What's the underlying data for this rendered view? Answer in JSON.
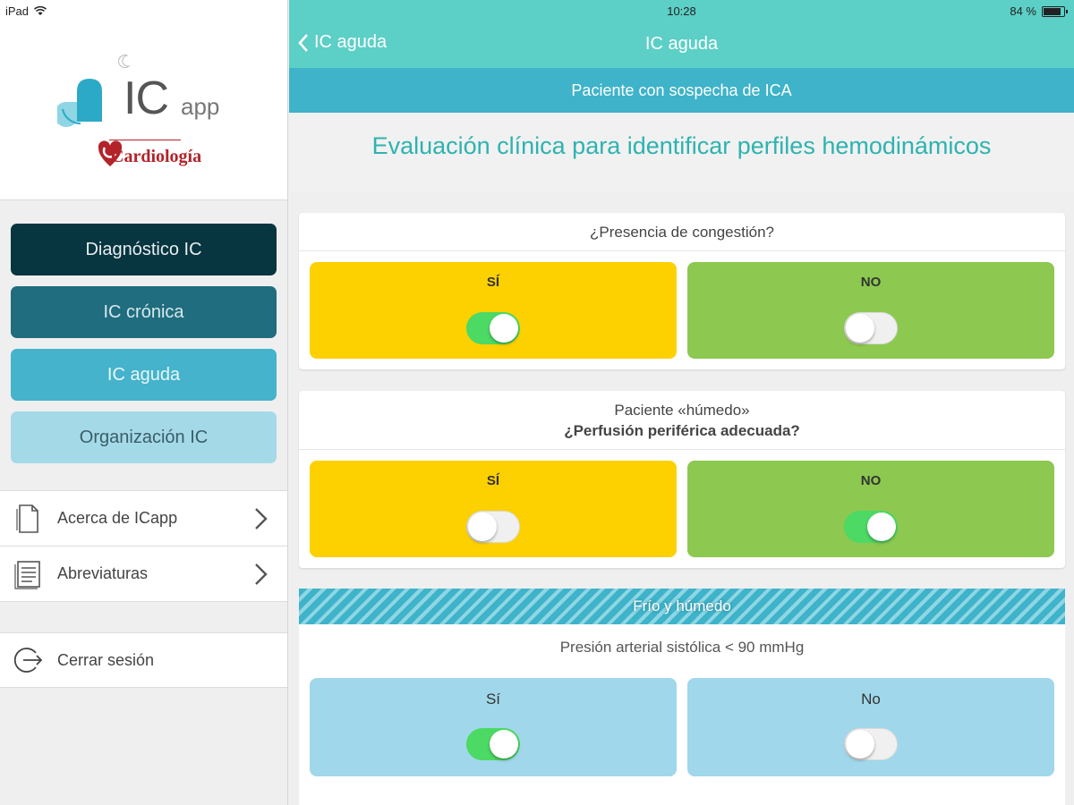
{
  "status": {
    "device": "iPad",
    "time": "10:28",
    "battery": "84 %"
  },
  "sidebar": {
    "app_name": "IC",
    "app_suffix": "app",
    "society": "Cardiología",
    "menu": [
      {
        "label": "Diagnóstico IC"
      },
      {
        "label": "IC crónica"
      },
      {
        "label": "IC aguda"
      },
      {
        "label": "Organización IC"
      }
    ],
    "links": [
      {
        "label": "Acerca de ICapp",
        "icon": "document-icon"
      },
      {
        "label": "Abreviaturas",
        "icon": "list-document-icon"
      }
    ],
    "logout": {
      "label": "Cerrar sesión",
      "icon": "logout-icon"
    }
  },
  "navbar": {
    "back_label": "IC aguda",
    "title": "IC aguda"
  },
  "subheader": "Paciente con sospecha de ICA",
  "heading": "Evaluación clínica para identificar perfiles hemodinámicos",
  "questions": [
    {
      "line1": "¿Presencia de congestión?",
      "yes_label": "SÍ",
      "no_label": "NO",
      "yes_on": true,
      "no_on": false
    },
    {
      "line1": "Paciente «húmedo»",
      "line2": "¿Perfusión periférica adecuada?",
      "yes_label": "SÍ",
      "no_label": "NO",
      "yes_on": false,
      "no_on": true
    }
  ],
  "profile_banner": "Frío y húmedo",
  "question3": {
    "text": "Presión arterial sistólica < 90 mmHg",
    "yes_label": "Sí",
    "no_label": "No",
    "yes_on": true,
    "no_on": false
  },
  "colors": {
    "navbar": "#5ccfc6",
    "subbar": "#3eb3c9",
    "heading_text": "#2db3b0",
    "yes_option": "#fdd000",
    "no_option": "#8dc850",
    "blue_option": "#a0d7ea",
    "toggle_on": "#4cd964"
  }
}
